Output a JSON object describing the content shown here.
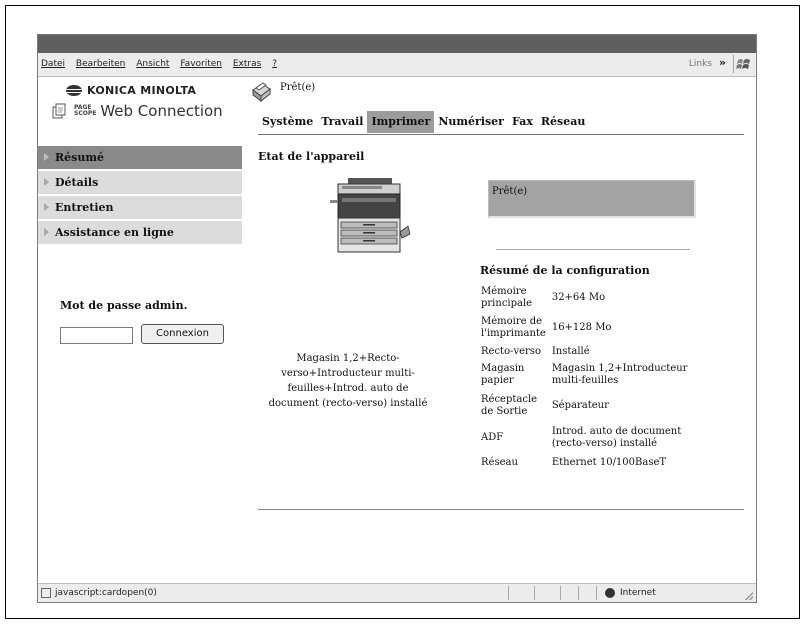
{
  "browser": {
    "menu": [
      "Datei",
      "Bearbeiten",
      "Ansicht",
      "Favoriten",
      "Extras",
      "?"
    ],
    "links_label": "Links",
    "links_chevron": "»",
    "status_url": "javascript:cardopen(0)",
    "zone": "Internet"
  },
  "brand": {
    "company": "KONICA MINOLTA",
    "pagescope_line1": "PAGE",
    "pagescope_line2": "SCOPE",
    "product": "Web Connection"
  },
  "device_status": "Prêt(e)",
  "tabs": [
    {
      "label": "Système",
      "active": false
    },
    {
      "label": "Travail",
      "active": false
    },
    {
      "label": "Imprimer",
      "active": true
    },
    {
      "label": "Numériser",
      "active": false
    },
    {
      "label": "Fax",
      "active": false
    },
    {
      "label": "Réseau",
      "active": false
    }
  ],
  "sidebar": {
    "items": [
      {
        "label": "Résumé",
        "active": true
      },
      {
        "label": "Détails",
        "active": false
      },
      {
        "label": "Entretien",
        "active": false
      },
      {
        "label": "Assistance en ligne",
        "active": false
      }
    ]
  },
  "admin": {
    "label": "Mot de passe admin.",
    "password_value": "",
    "login_button": "Connexion"
  },
  "main": {
    "section_title": "Etat de l'appareil",
    "device_description": "Magasin 1,2+Recto-verso+Introducteur multi-feuilles+Introd. auto de document (recto-verso) installé",
    "status_box": "Prêt(e)",
    "config_title": "Résumé de la configuration",
    "config_rows": [
      {
        "key": "Mémoire principale",
        "value": "32+64 Mo"
      },
      {
        "key": "Mémoire de l'imprimante",
        "value": "16+128 Mo"
      },
      {
        "key": "Recto-verso",
        "value": "Installé"
      },
      {
        "key": "Magasin papier",
        "value": "Magasin 1,2+Introducteur multi-feuilles"
      },
      {
        "key": "Réceptacle de Sortie",
        "value": "Séparateur"
      },
      {
        "key": "ADF",
        "value": "Introd. auto de document (recto-verso) installé"
      },
      {
        "key": "Réseau",
        "value": "Ethernet 10/100BaseT"
      }
    ]
  }
}
